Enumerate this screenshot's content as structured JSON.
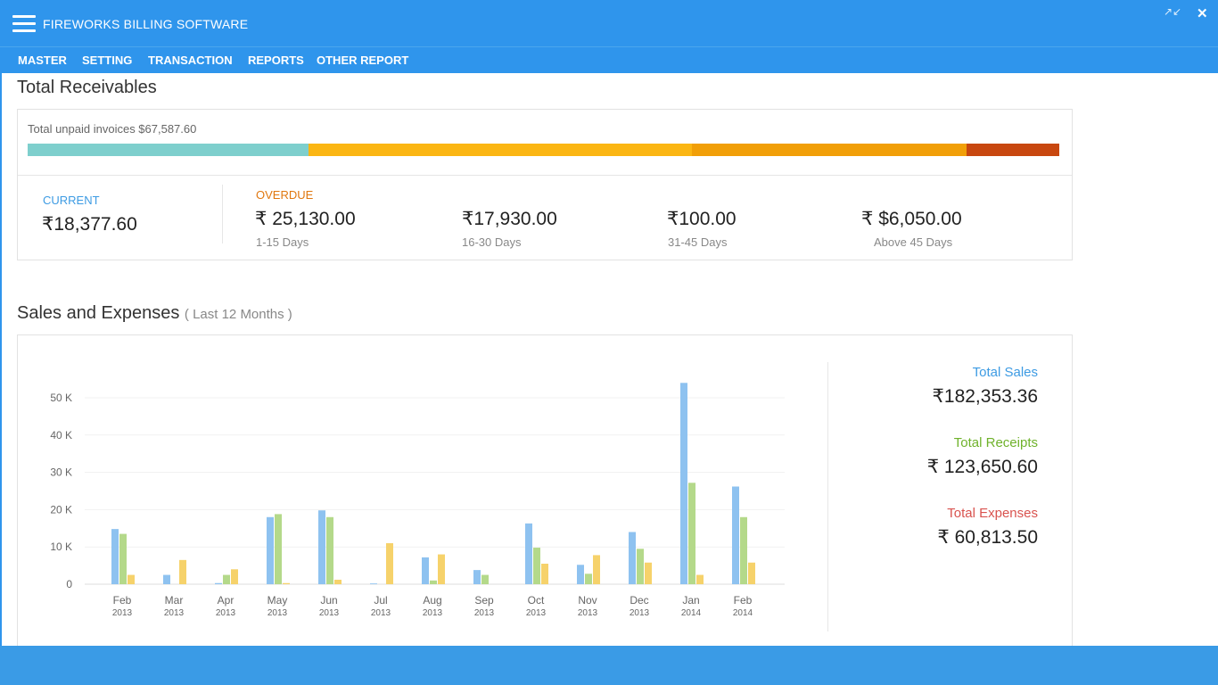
{
  "window": {
    "title": "FIREWORKS BILLING SOFTWARE",
    "restore_glyph": "↗↙",
    "close_glyph": "✕"
  },
  "menu": [
    "MASTER",
    "SETTING",
    "TRANSACTION",
    "REPORTS",
    "OTHER REPORT"
  ],
  "receivables": {
    "title": "Total Receivables",
    "unpaid_label": "Total unpaid invoices $67,587.60",
    "bar_segments": [
      {
        "name": "current",
        "fraction": 0.272,
        "color": "#7ecfcd"
      },
      {
        "name": "1-15",
        "fraction": 0.372,
        "color": "#fbb613"
      },
      {
        "name": "16-30",
        "fraction": 0.266,
        "color": "#f19f08"
      },
      {
        "name": "above-45",
        "fraction": 0.09,
        "color": "#c8470f"
      }
    ],
    "current_label": "CURRENT",
    "current_amount": "₹18,377.60",
    "overdue_label": "OVERDUE",
    "buckets": [
      {
        "amount": "₹ 25,130.00",
        "range": "1-15 Days"
      },
      {
        "amount": "₹17,930.00",
        "range": "16-30 Days"
      },
      {
        "amount": "₹100.00",
        "range": "31-45 Days"
      },
      {
        "amount": "₹ $6,050.00",
        "range": "Above 45 Days"
      }
    ]
  },
  "sales": {
    "title": "Sales and Expenses",
    "subtitle": "( Last 12 Months )",
    "total_sales_label": "Total Sales",
    "total_sales_value": "₹182,353.36",
    "total_receipts_label": "Total Receipts",
    "total_receipts_value": "₹ 123,650.60",
    "total_expenses_label": "Total Expenses",
    "total_expenses_value": "₹ 60,813.50",
    "colors": {
      "sales": "#3d9be3",
      "receipts": "#6fb22b",
      "expenses": "#d9534f"
    }
  },
  "chart_data": {
    "type": "bar",
    "categories": [
      "Feb",
      "Mar",
      "Apr",
      "May",
      "Jun",
      "Jul",
      "Aug",
      "Sep",
      "Oct",
      "Nov",
      "Dec",
      "Jan",
      "Feb"
    ],
    "category_years": [
      "2013",
      "2013",
      "2013",
      "2013",
      "2013",
      "2013",
      "2013",
      "2013",
      "2013",
      "2013",
      "2013",
      "2014",
      "2014"
    ],
    "series": [
      {
        "values": [
          14.8,
          2.5,
          0.3,
          18,
          19.8,
          0.2,
          7.2,
          3.8,
          16.3,
          5.2,
          14,
          54,
          26.2
        ],
        "color": "#8ec2f0"
      },
      {
        "values": [
          13.5,
          0,
          2.5,
          18.8,
          18,
          0,
          1,
          2.5,
          9.8,
          2.8,
          9.5,
          27.2,
          18
        ],
        "color": "#b4d98a"
      },
      {
        "values": [
          2.5,
          6.5,
          4,
          0.3,
          1.2,
          11,
          8,
          0,
          5.5,
          7.8,
          5.8,
          2.5,
          5.8
        ],
        "color": "#f6d26b"
      }
    ],
    "y_ticks": [
      "0",
      "10 K",
      "20 K",
      "30 K",
      "40 K",
      "50 K"
    ],
    "ylim": [
      0,
      55
    ],
    "grid": true
  }
}
